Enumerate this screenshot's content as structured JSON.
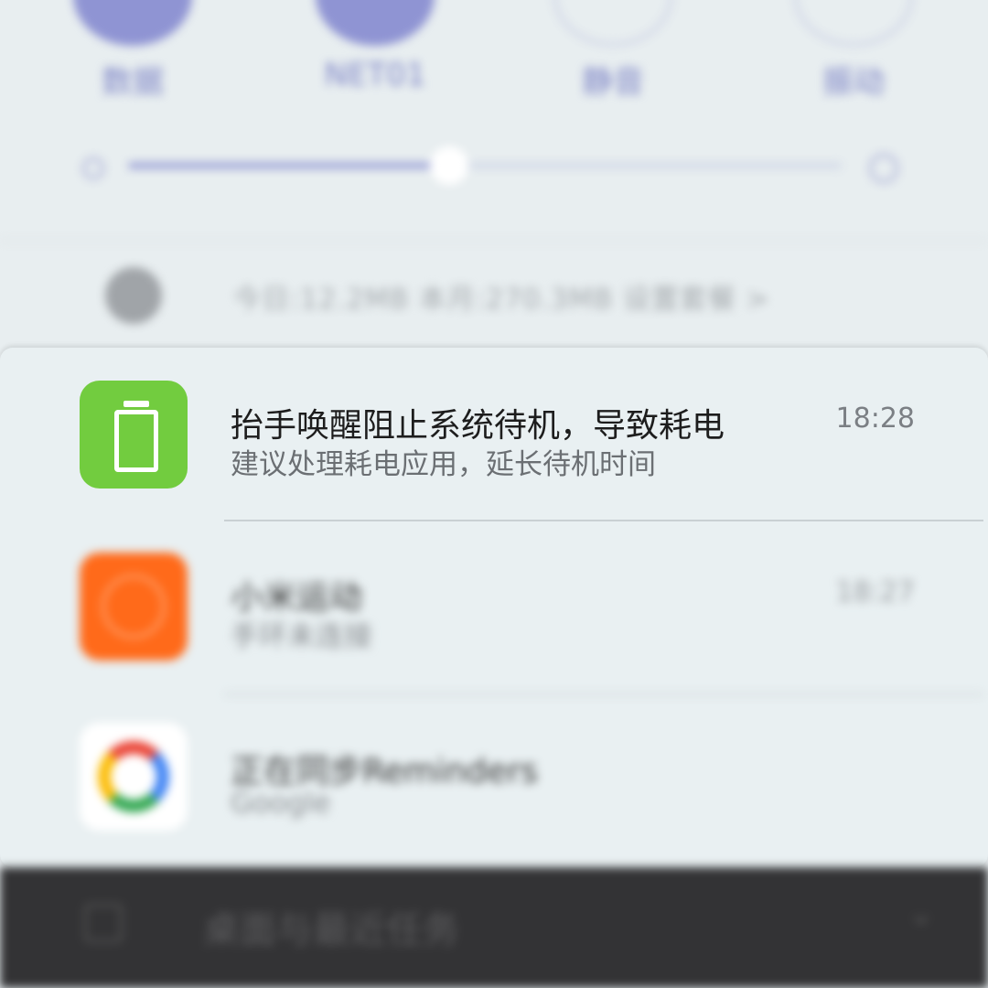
{
  "quick_settings": {
    "toggles": [
      {
        "label": "数据",
        "active": true
      },
      {
        "label": "NET01",
        "active": true
      },
      {
        "label": "静音",
        "active": false
      },
      {
        "label": "振动",
        "active": false
      }
    ],
    "brightness_level": 0.45
  },
  "data_usage": {
    "text": "今日:12.2MB    本月:270.3MB    设置套餐 >"
  },
  "notifications": [
    {
      "title": "抬手唤醒阻止系统待机，导致耗电",
      "subtitle": "建议处理耗电应用，延长待机时间",
      "time": "18:28",
      "icon": "battery-icon",
      "icon_color": "#72cc3f"
    },
    {
      "title": "小米运动",
      "subtitle": "手环未连接",
      "time": "18:27",
      "icon": "mi-fit-icon",
      "icon_color": "#ff6a1a"
    },
    {
      "title": "正在同步Reminders",
      "subtitle": "Google",
      "time": "",
      "icon": "google-icon",
      "icon_color": "#ffffff"
    }
  ],
  "bottom_bar": {
    "label": "桌面与最近任务"
  }
}
